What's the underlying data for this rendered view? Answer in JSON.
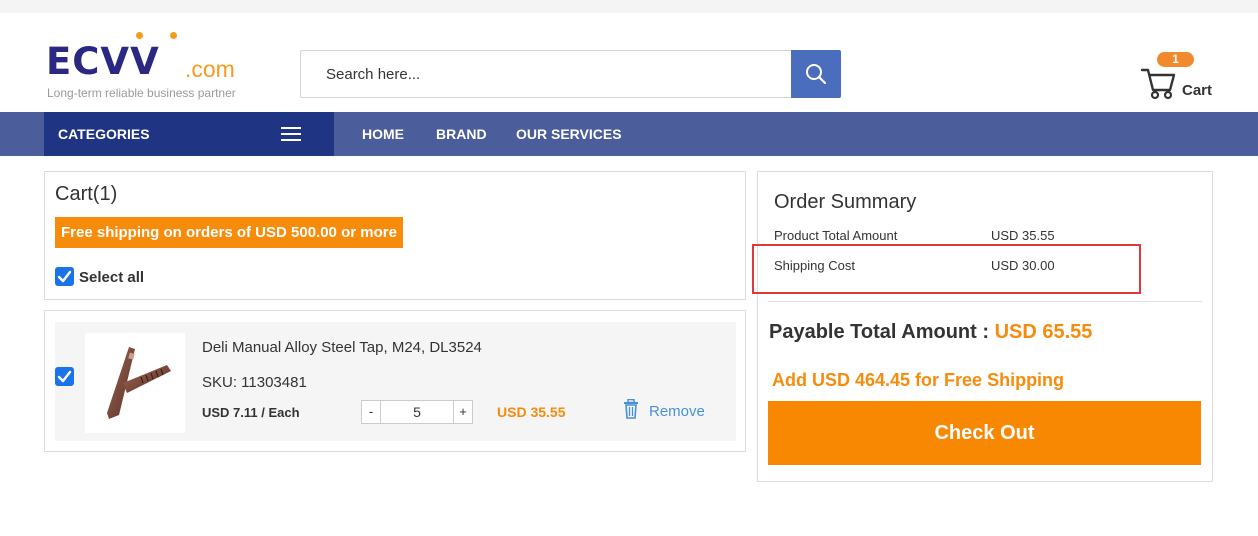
{
  "header": {
    "logo": {
      "brand": "ECVV",
      "suffix": ".com",
      "tagline": "Long-term reliable business partner"
    },
    "search": {
      "placeholder": "Search here...",
      "value": "",
      "button_icon": "search-icon"
    },
    "cart": {
      "count": "1",
      "label": "Cart",
      "icon": "shopping-cart-icon"
    }
  },
  "nav": {
    "categories_label": "CATEGORIES",
    "categories_icon": "hamburger-menu-icon",
    "links": [
      "HOME",
      "BRAND",
      "OUR SERVICES"
    ]
  },
  "cart": {
    "title": "Cart(1)",
    "free_shipping_banner": "Free shipping on orders of USD 500.00 or more",
    "select_all_label": "Select all",
    "select_all_checked": true,
    "items": [
      {
        "checked": true,
        "name": "Deli Manual Alloy Steel Tap, M24, DL3524",
        "sku": "SKU: 11303481",
        "unit_price": "USD 7.11 / Each",
        "qty_minus": "-",
        "quantity": "5",
        "qty_plus": "+",
        "total": "USD 35.55",
        "remove_label": "Remove",
        "remove_icon": "trash-icon"
      }
    ]
  },
  "summary": {
    "title": "Order Summary",
    "rows": [
      {
        "label": "Product Total Amount",
        "value": "USD 35.55"
      },
      {
        "label": "Shipping Cost",
        "value": "USD 30.00"
      }
    ],
    "highlight_color": "#e0383b",
    "payable_label": "Payable Total Amount :",
    "payable_amount": "USD 65.55",
    "free_shipping_hint": "Add USD 464.45 for Free Shipping",
    "checkout_label": "Check Out"
  },
  "colors": {
    "brand_navy": "#2a2882",
    "brand_orange": "#f39c1f",
    "nav_bar": "#4b5d9b",
    "categories_bg": "#1f3584",
    "accent_orange": "#f78b0c",
    "checkbox_blue": "#1a73e8"
  }
}
